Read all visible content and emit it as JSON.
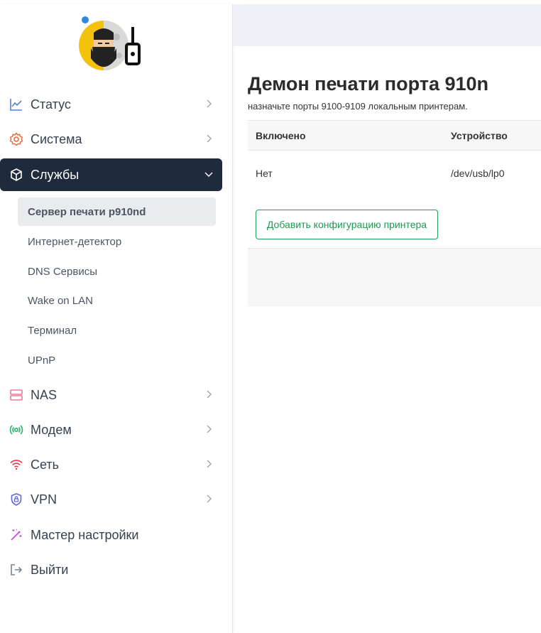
{
  "sidebar": {
    "items": [
      {
        "label": "Статус",
        "icon": "chart-line-icon",
        "color": "#5b7fd6"
      },
      {
        "label": "Система",
        "icon": "gear-icon",
        "color": "#e8663d"
      },
      {
        "label": "Службы",
        "icon": "cube-icon",
        "color": "#ffffff"
      },
      {
        "label": "NAS",
        "icon": "server-icon",
        "color": "#e77a9a"
      },
      {
        "label": "Модем",
        "icon": "broadcast-icon",
        "color": "#27b36a"
      },
      {
        "label": "Сеть",
        "icon": "wifi-icon",
        "color": "#e6394a"
      },
      {
        "label": "VPN",
        "icon": "shield-icon",
        "color": "#6366d9"
      },
      {
        "label": "Мастер настройки",
        "icon": "magic-wand-icon",
        "color": "#c94fd8"
      },
      {
        "label": "Выйти",
        "icon": "logout-icon",
        "color": "#7b8494"
      }
    ],
    "services_sub": [
      {
        "label": "Сервер печати p910nd"
      },
      {
        "label": "Интернет-детектор"
      },
      {
        "label": "DNS Сервисы"
      },
      {
        "label": "Wake on LAN"
      },
      {
        "label": "Терминал"
      },
      {
        "label": "UPnP"
      }
    ]
  },
  "main": {
    "title": "Демон печати порта 910n",
    "description": "назначьте порты 9100-9109 локальным принтерам.",
    "table": {
      "headers": [
        "Включено",
        "Устройство"
      ],
      "rows": [
        [
          "Нет",
          "/dev/usb/lp0"
        ]
      ]
    },
    "add_button": "Добавить конфигурацию принтера"
  },
  "colors": {
    "active_bg": "#1f2a3c",
    "accent_green": "#1a9b52",
    "header_bg": "#eef0f5"
  }
}
